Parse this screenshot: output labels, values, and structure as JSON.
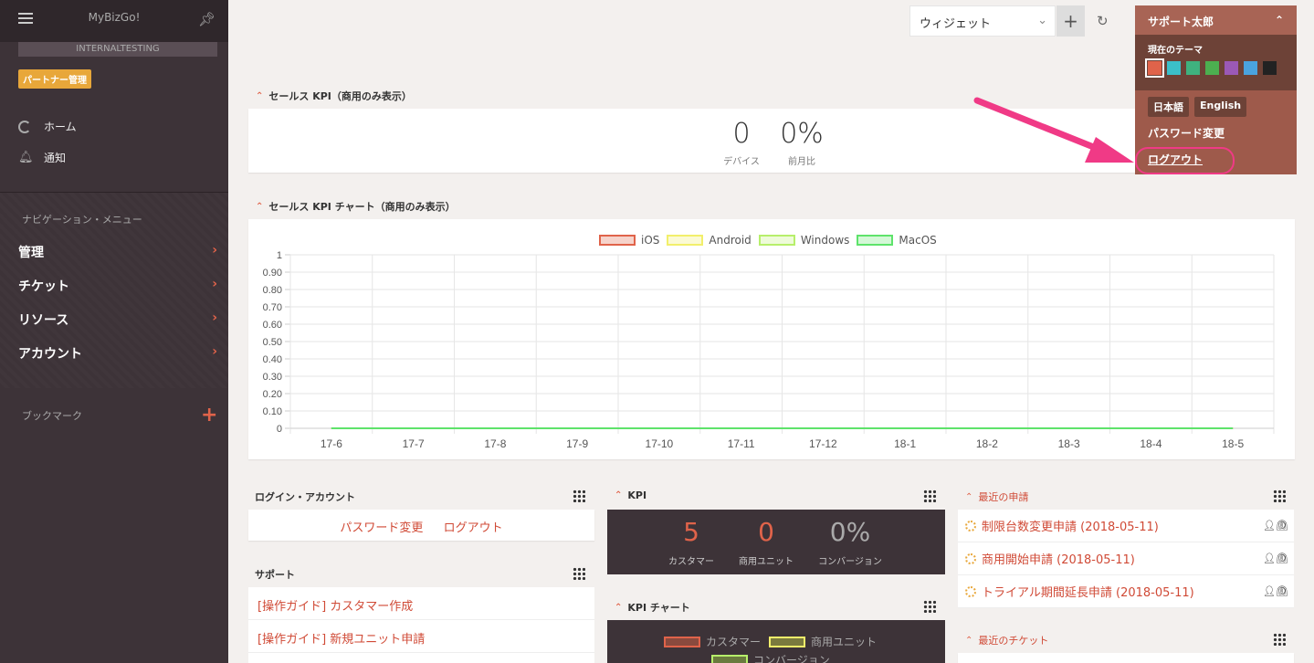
{
  "sidebar": {
    "app_name": "MyBizGo!",
    "env_label": "INTERNALTESTING",
    "partner_badge": "パートナー管理",
    "home": "ホーム",
    "notifications": "通知",
    "nav_heading": "ナビゲーション・メニュー",
    "nav_items": [
      {
        "label": "管理"
      },
      {
        "label": "チケット"
      },
      {
        "label": "リソース"
      },
      {
        "label": "アカウント"
      }
    ],
    "bookmark": "ブックマーク"
  },
  "toolbar": {
    "widget_select": "ウィジェット",
    "add_label": "+",
    "refresh_icon": "refresh-icon"
  },
  "user_menu": {
    "user_name": "サポート太郎",
    "theme_label": "現在のテーマ",
    "theme_colors": [
      "#e0634a",
      "#3bbfc9",
      "#3fb27f",
      "#4caf50",
      "#9b59b6",
      "#4aa3df",
      "#222222"
    ],
    "lang_ja": "日本語",
    "lang_en": "English",
    "password_change": "パスワード変更",
    "logout": "ログアウト"
  },
  "sales_kpi": {
    "title": "セールス KPI（商用のみ表示）",
    "devices_value": "0",
    "devices_label": "デバイス",
    "mom_value": "0%",
    "mom_label": "前月比"
  },
  "sales_chart": {
    "title": "セールス KPI チャート（商用のみ表示）"
  },
  "chart_data": {
    "type": "line",
    "categories": [
      "17-6",
      "17-7",
      "17-8",
      "17-9",
      "17-10",
      "17-11",
      "17-12",
      "18-1",
      "18-2",
      "18-3",
      "18-4",
      "18-5"
    ],
    "yticks": [
      "0",
      "0.10",
      "0.20",
      "0.30",
      "0.40",
      "0.50",
      "0.60",
      "0.70",
      "0.80",
      "0.90",
      "1"
    ],
    "ylim": [
      0,
      1
    ],
    "grid": true,
    "legend_position": "top",
    "series": [
      {
        "name": "iOS",
        "color": "#e0634a",
        "fill": "#f6d3cb",
        "values": [
          0,
          0,
          0,
          0,
          0,
          0,
          0,
          0,
          0,
          0,
          0,
          0
        ]
      },
      {
        "name": "Android",
        "color": "#f2ef6b",
        "fill": "#fbfad4",
        "values": [
          0,
          0,
          0,
          0,
          0,
          0,
          0,
          0,
          0,
          0,
          0,
          0
        ]
      },
      {
        "name": "Windows",
        "color": "#b7ef6b",
        "fill": "#eefbd9",
        "values": [
          0,
          0,
          0,
          0,
          0,
          0,
          0,
          0,
          0,
          0,
          0,
          0
        ]
      },
      {
        "name": "MacOS",
        "color": "#5ee36b",
        "fill": "#d4f8d7",
        "values": [
          0,
          0,
          0,
          0,
          0,
          0,
          0,
          0,
          0,
          0,
          0,
          0
        ]
      }
    ]
  },
  "login_account": {
    "title": "ログイン・アカウント",
    "password_change": "パスワード変更",
    "logout": "ログアウト"
  },
  "support": {
    "title": "サポート",
    "items": [
      "[操作ガイド] カスタマー作成",
      "[操作ガイド] 新規ユニット申請"
    ]
  },
  "kpi": {
    "title": "KPI",
    "customers_value": "5",
    "customers_label": "カスタマー",
    "units_value": "0",
    "units_label": "商用ユニット",
    "conversion_value": "0%",
    "conversion_label": "コンバージョン"
  },
  "kpi_chart": {
    "title": "KPI チャート",
    "legend": [
      "カスタマー",
      "商用ユニット",
      "コンバージョン"
    ]
  },
  "recent_requests": {
    "title": "最近の申請",
    "items": [
      "制限台数変更申請 (2018-05-11)",
      "商用開始申請 (2018-05-11)",
      "トライアル期間延長申請 (2018-05-11)"
    ]
  },
  "recent_tickets": {
    "title": "最近のチケット"
  }
}
